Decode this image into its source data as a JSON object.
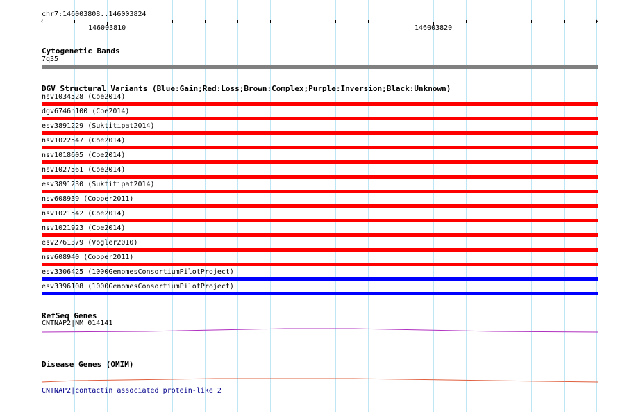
{
  "ruler": {
    "range": "chr7:146003808..146003824",
    "tick_labels": [
      "146003810",
      "146003820"
    ]
  },
  "cytoband": {
    "title": "Cytogenetic Bands",
    "band_label": "7q35",
    "band_color": "#808080"
  },
  "dgv": {
    "title": "DGV Structural Variants (Blue:Gain;Red:Loss;Brown:Complex;Purple:Inversion;Black:Unknown)",
    "variants": [
      {
        "label": "nsv1034528 (Coe2014)",
        "type": "Loss"
      },
      {
        "label": "dgv6746n100 (Coe2014)",
        "type": "Loss"
      },
      {
        "label": "esv3891229 (Suktitipat2014)",
        "type": "Loss"
      },
      {
        "label": "nsv1022547 (Coe2014)",
        "type": "Loss"
      },
      {
        "label": "nsv1018605 (Coe2014)",
        "type": "Loss"
      },
      {
        "label": "nsv1027561 (Coe2014)",
        "type": "Loss"
      },
      {
        "label": "esv3891230 (Suktitipat2014)",
        "type": "Loss"
      },
      {
        "label": "nsv608939 (Cooper2011)",
        "type": "Loss"
      },
      {
        "label": "nsv1021542 (Coe2014)",
        "type": "Loss"
      },
      {
        "label": "nsv1021923 (Coe2014)",
        "type": "Loss"
      },
      {
        "label": "esv2761379 (Vogler2010)",
        "type": "Loss"
      },
      {
        "label": "nsv608940 (Cooper2011)",
        "type": "Loss"
      },
      {
        "label": "esv3306425 (1000GenomesConsortiumPilotProject)",
        "type": "Gain"
      },
      {
        "label": "esv3396108 (1000GenomesConsortiumPilotProject)",
        "type": "Gain"
      }
    ],
    "colors": {
      "Gain": "#0000ff",
      "Loss": "#ff0000"
    }
  },
  "refseq": {
    "title": "RefSeq Genes",
    "gene_label": "CNTNAP2|NM_014141",
    "color": "#b030c0"
  },
  "omim": {
    "title": "Disease Genes (OMIM)",
    "gene_label": "CNTNAP2|contactin associated protein-like 2",
    "color": "#e06040"
  }
}
